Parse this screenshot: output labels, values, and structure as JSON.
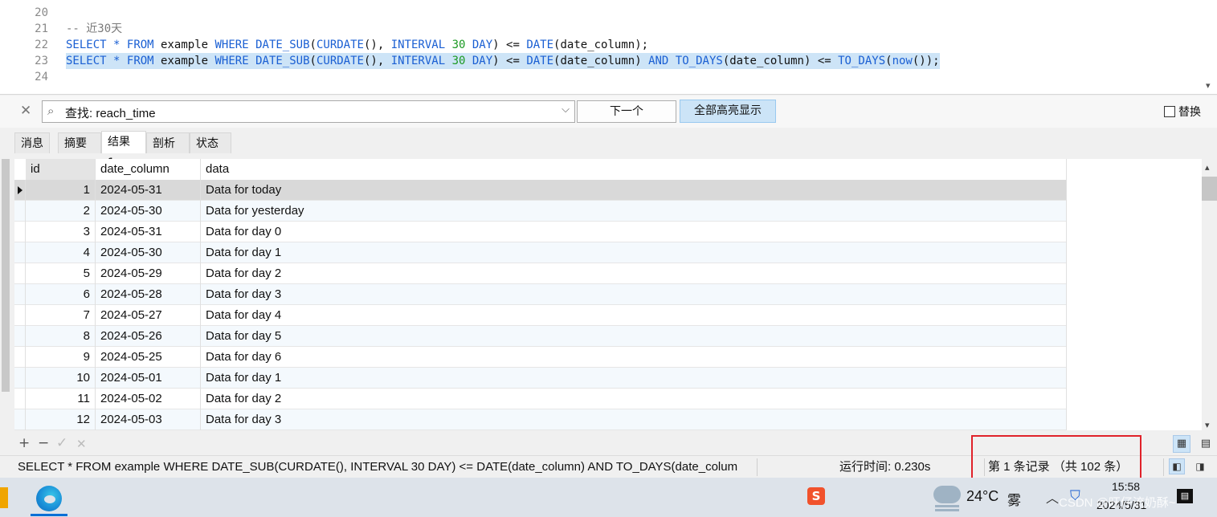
{
  "editor": {
    "lines": [
      {
        "num": "20",
        "text": ""
      },
      {
        "num": "21",
        "text": "-- 近30天"
      },
      {
        "num": "22",
        "text": "SELECT * FROM example WHERE DATE_SUB(CURDATE(), INTERVAL 30 DAY) <= DATE(date_column);"
      },
      {
        "num": "23",
        "text": "SELECT * FROM example WHERE DATE_SUB(CURDATE(), INTERVAL 30 DAY) <= DATE(date_column) AND TO_DAYS(date_column) <= TO_DAYS(now());"
      },
      {
        "num": "24",
        "text": ""
      }
    ]
  },
  "find": {
    "label": "查找: reach_time",
    "next_label": "下一个",
    "highlight_all_label": "全部高亮显示",
    "replace_label": "替换"
  },
  "tabs": [
    "消息",
    "摘要",
    "结果 1",
    "剖析",
    "状态"
  ],
  "grid": {
    "columns": [
      "id",
      "date_column",
      "data"
    ],
    "rows": [
      {
        "id": "1",
        "date": "2024-05-31",
        "data": "Data for today"
      },
      {
        "id": "2",
        "date": "2024-05-30",
        "data": "Data for yesterday"
      },
      {
        "id": "3",
        "date": "2024-05-31",
        "data": "Data for day 0"
      },
      {
        "id": "4",
        "date": "2024-05-30",
        "data": "Data for day 1"
      },
      {
        "id": "5",
        "date": "2024-05-29",
        "data": "Data for day 2"
      },
      {
        "id": "6",
        "date": "2024-05-28",
        "data": "Data for day 3"
      },
      {
        "id": "7",
        "date": "2024-05-27",
        "data": "Data for day 4"
      },
      {
        "id": "8",
        "date": "2024-05-26",
        "data": "Data for day 5"
      },
      {
        "id": "9",
        "date": "2024-05-25",
        "data": "Data for day 6"
      },
      {
        "id": "10",
        "date": "2024-05-01",
        "data": "Data for day 1"
      },
      {
        "id": "11",
        "date": "2024-05-02",
        "data": "Data for day 2"
      },
      {
        "id": "12",
        "date": "2024-05-03",
        "data": "Data for day 3"
      }
    ]
  },
  "toolbar": {
    "add": "+",
    "remove": "−",
    "apply": "✓",
    "discard": "✕"
  },
  "status": {
    "sql": "SELECT * FROM example WHERE DATE_SUB(CURDATE(), INTERVAL 30 DAY) <= DATE(date_column) AND TO_DAYS(date_colum",
    "runtime": "运行时间: 0.230s",
    "record": "第 1 条记录 （共 102 条）"
  },
  "taskbar": {
    "temperature": "24°C",
    "weather": "雾",
    "time": "15:58",
    "date": "2024/5/31",
    "watermark": "CSDN @旺仔流奶酥~"
  }
}
